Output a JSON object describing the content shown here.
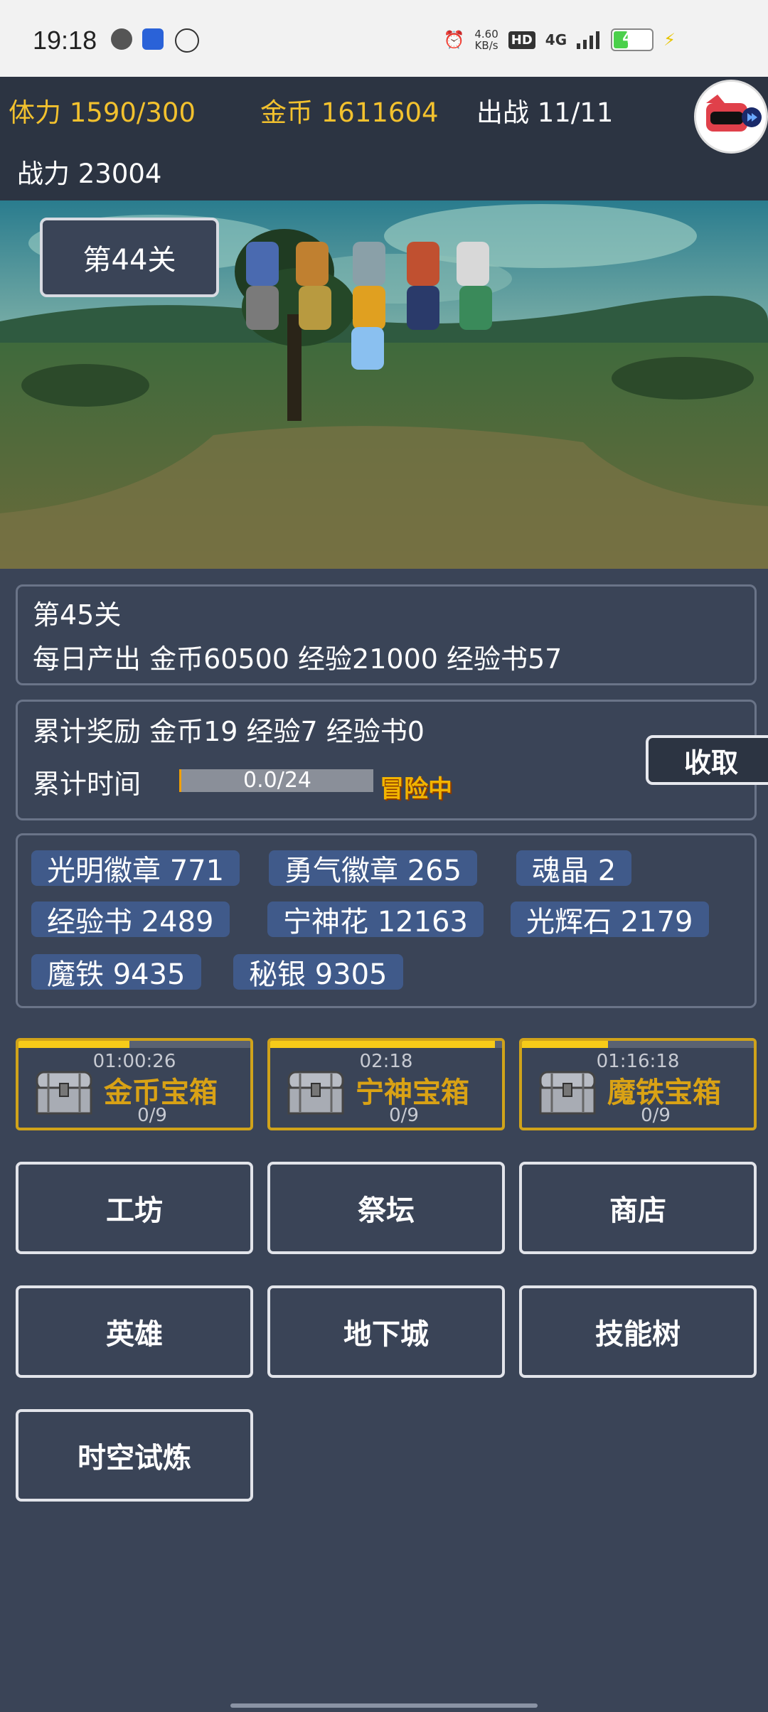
{
  "status_bar": {
    "time": "19:18",
    "speed": "4.60",
    "speed_unit": "KB/s",
    "hd": "HD",
    "network": "4G",
    "battery": "41",
    "battery_level": 0.41
  },
  "top": {
    "stamina": "体力 1590/300",
    "gold": "金币 1611604",
    "deploy": "出战 11/11",
    "power": "战力 23004"
  },
  "scene": {
    "stage": "第44关"
  },
  "next_stage": {
    "title": "第45关",
    "output": "每日产出  金币60500  经验21000  经验书57"
  },
  "rewards": {
    "line": "累计奖励  金币19  经验7  经验书0",
    "time_label": "累计时间",
    "progress_text": "0.0/24",
    "progress": 0.0,
    "adventure": "冒险中",
    "collect": "收取"
  },
  "inventory": [
    "光明徽章 771",
    "勇气徽章 265",
    "魂晶 2",
    "经验书 2489",
    "宁神花 12163",
    "光辉石 2179",
    "魔铁 9435",
    "秘银 9305"
  ],
  "chests": [
    {
      "timer": "01:00:26",
      "name": "金币宝箱",
      "count": "0/9",
      "progress": 0.48
    },
    {
      "timer": "02:18",
      "name": "宁神宝箱",
      "count": "0/9",
      "progress": 0.97
    },
    {
      "timer": "01:16:18",
      "name": "魔铁宝箱",
      "count": "0/9",
      "progress": 0.37
    }
  ],
  "menu": [
    "工坊",
    "祭坛",
    "商店",
    "英雄",
    "地下城",
    "技能树",
    "时空试炼"
  ],
  "colors": {
    "gold": "#f2c12e",
    "chip": "#405a8a",
    "chest_border": "#d0a31a",
    "background": "#3a4457"
  }
}
